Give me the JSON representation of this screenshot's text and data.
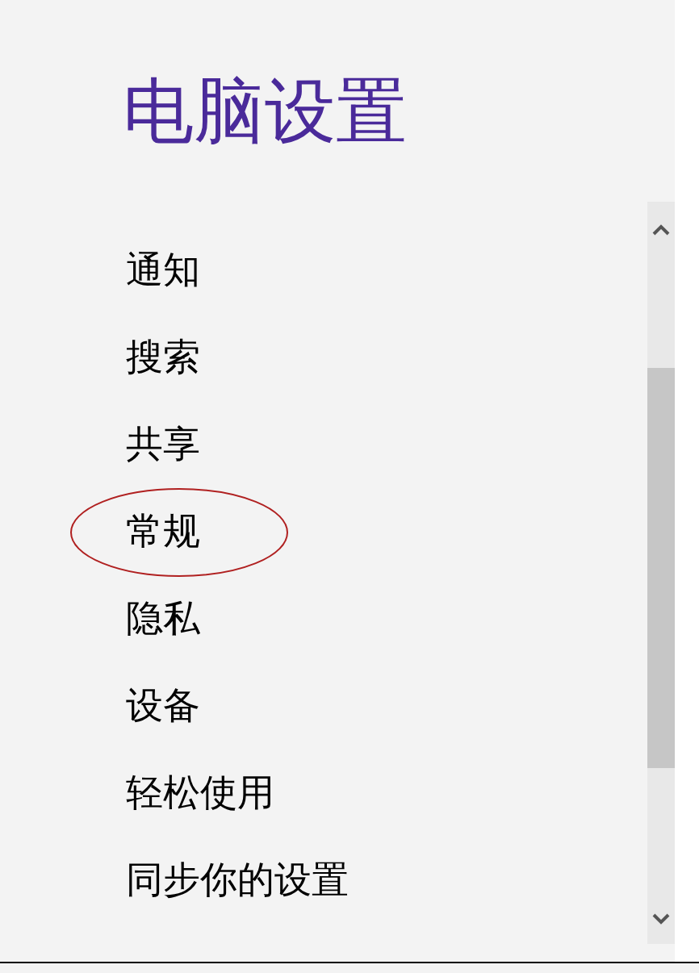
{
  "title": "电脑设置",
  "items": [
    {
      "label": "通知",
      "circled": false
    },
    {
      "label": "搜索",
      "circled": false
    },
    {
      "label": "共享",
      "circled": false
    },
    {
      "label": "常规",
      "circled": true
    },
    {
      "label": "隐私",
      "circled": false
    },
    {
      "label": "设备",
      "circled": false
    },
    {
      "label": "轻松使用",
      "circled": false
    },
    {
      "label": "同步你的设置",
      "circled": false
    }
  ]
}
